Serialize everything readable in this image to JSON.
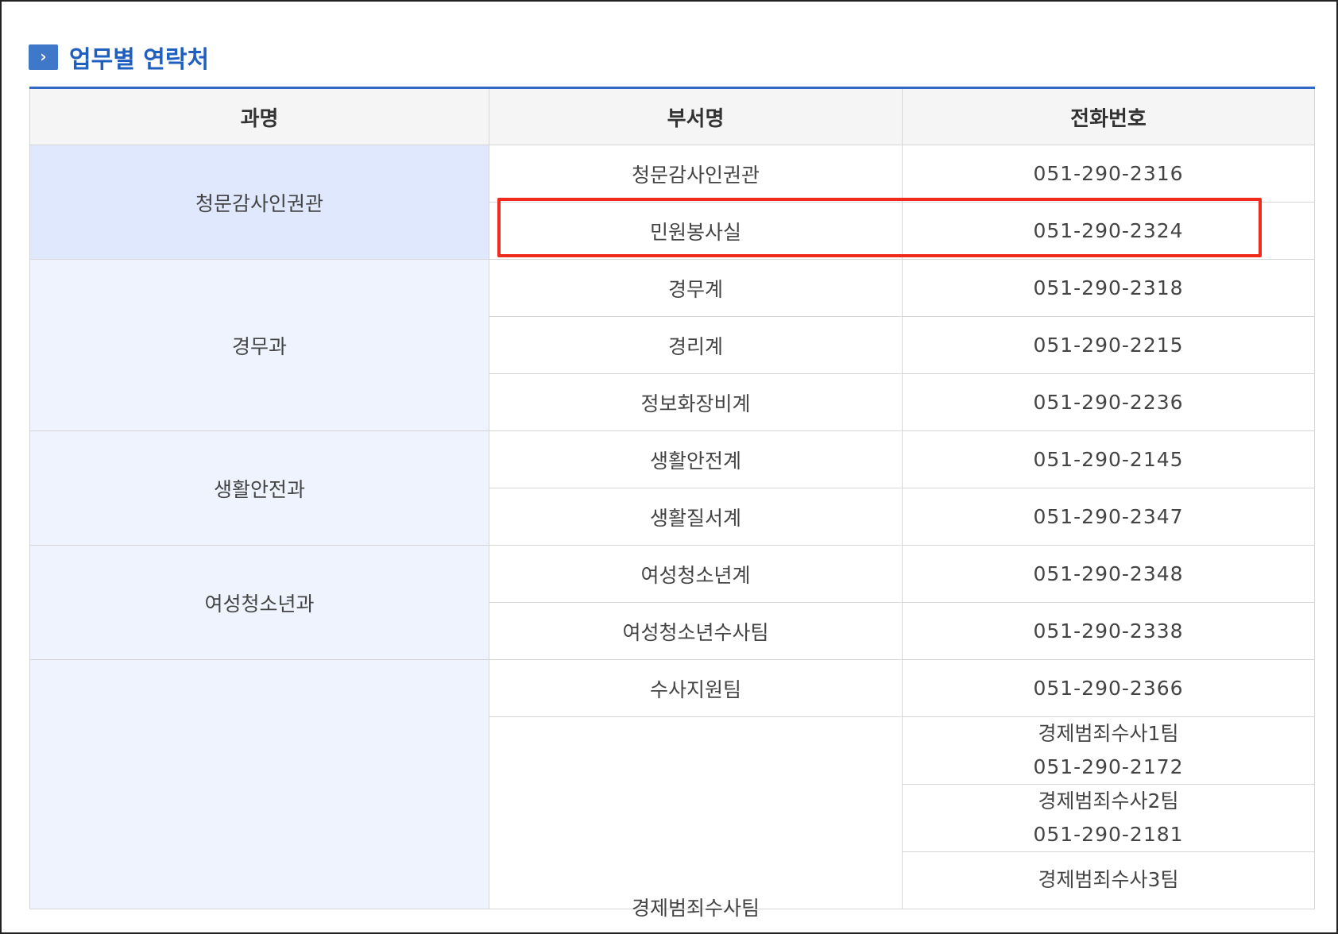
{
  "section": {
    "icon": "chevron-right-icon",
    "title": "업무별 연락처"
  },
  "table": {
    "headers": [
      "과명",
      "부서명",
      "전화번호"
    ],
    "groups": [
      {
        "name": "청문감사인권관",
        "rows": [
          {
            "dept": "청문감사인권관",
            "phone": "051-290-2316"
          },
          {
            "dept": "민원봉사실",
            "phone": "051-290-2324"
          }
        ]
      },
      {
        "name": "경무과",
        "rows": [
          {
            "dept": "경무계",
            "phone": "051-290-2318"
          },
          {
            "dept": "경리계",
            "phone": "051-290-2215"
          },
          {
            "dept": "정보화장비계",
            "phone": "051-290-2236"
          }
        ]
      },
      {
        "name": "생활안전과",
        "rows": [
          {
            "dept": "생활안전계",
            "phone": "051-290-2145"
          },
          {
            "dept": "생활질서계",
            "phone": "051-290-2347"
          }
        ]
      },
      {
        "name": "여성청소년과",
        "rows": [
          {
            "dept": "여성청소년계",
            "phone": "051-290-2348"
          },
          {
            "dept": "여성청소년수사팀",
            "phone": "051-290-2338"
          }
        ]
      },
      {
        "name": "",
        "rows": [
          {
            "dept": "수사지원팀",
            "phone": "051-290-2366"
          }
        ],
        "subgroup": {
          "dept": "경제범죄수사팀",
          "teams": [
            {
              "team": "경제범죄수사1팀",
              "phone": "051-290-2172"
            },
            {
              "team": "경제범죄수사2팀",
              "phone": "051-290-2181"
            },
            {
              "team": "경제범죄수사3팀",
              "phone": ""
            }
          ]
        }
      }
    ]
  },
  "highlight_color": "#ee2b1c",
  "accent_color": "#2f68c6"
}
